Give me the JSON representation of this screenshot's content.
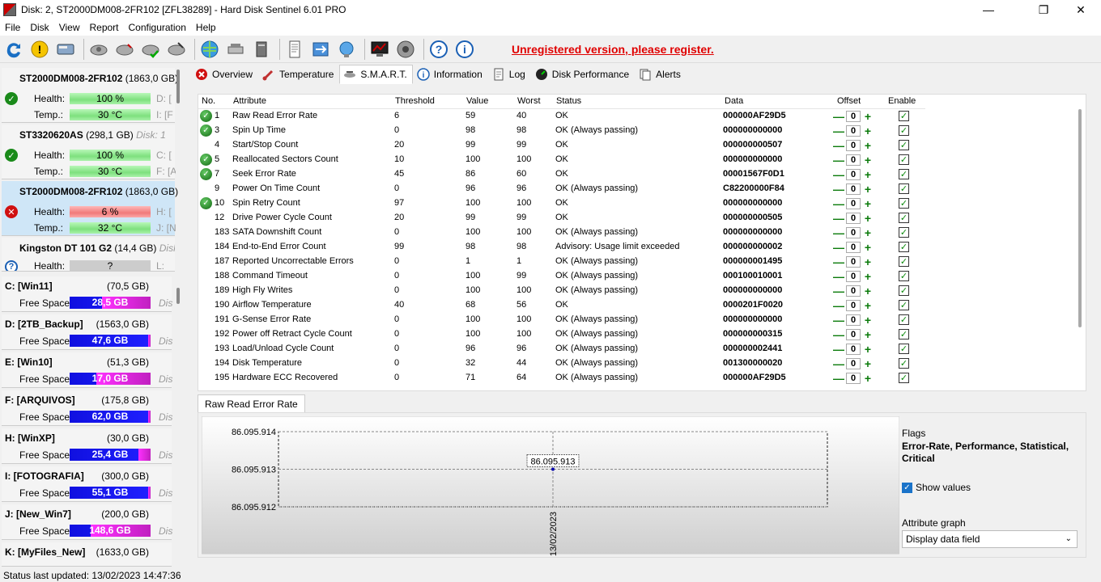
{
  "window": {
    "title": "Disk: 2, ST2000DM008-2FR102 [ZFL38289]  -  Hard Disk Sentinel 6.01 PRO"
  },
  "menu": [
    "File",
    "Disk",
    "View",
    "Report",
    "Configuration",
    "Help"
  ],
  "toolbar": {
    "unregistered": "Unregistered version, please register."
  },
  "disks": [
    {
      "name": "ST2000DM008-2FR102",
      "size": "(1863,0 GB)",
      "health_label": "Health:",
      "health": "100 %",
      "health_fraction": 1.0,
      "temp_label": "Temp.:",
      "temp": "30 °C",
      "tag1": "D: [",
      "tag2": "I: [F",
      "status": "ok"
    },
    {
      "name": "ST3320620AS",
      "size": "(298,1 GB)",
      "disk_tag": "Disk: 1",
      "health_label": "Health:",
      "health": "100 %",
      "health_fraction": 1.0,
      "temp_label": "Temp.:",
      "temp": "30 °C",
      "tag1": "C: [",
      "tag2": "F: [A",
      "status": "ok"
    },
    {
      "name": "ST2000DM008-2FR102",
      "size": "(1863,0 GB)",
      "health_label": "Health:",
      "health": "6 %",
      "health_fraction": 0.06,
      "temp_label": "Temp.:",
      "temp": "32 °C",
      "tag1": "H: [",
      "tag2": "J: [N",
      "status": "bad"
    },
    {
      "name": "Kingston DT 101 G2",
      "size": "(14,4 GB)",
      "disk_tag": "Disk",
      "health_label": "Health:",
      "health": "?",
      "tag1": "L:",
      "status": "unknown"
    }
  ],
  "volumes": [
    {
      "name": "C: [Win11]",
      "size": "(70,5 GB)",
      "free_label": "Free Space",
      "free": "28,5 GB",
      "free_fraction": 0.4,
      "tag": "Dis"
    },
    {
      "name": "D: [2TB_Backup]",
      "size": "(1563,0 GB)",
      "free_label": "Free Space",
      "free": "47,6 GB",
      "free_fraction": 0.97,
      "tag": "Dis"
    },
    {
      "name": "E: [Win10]",
      "size": "(51,3 GB)",
      "free_label": "Free Space",
      "free": "17,0 GB",
      "free_fraction": 0.33,
      "tag": "Dis"
    },
    {
      "name": "F: [ARQUIVOS]",
      "size": "(175,8 GB)",
      "free_label": "Free Space",
      "free": "62,0 GB",
      "free_fraction": 0.97,
      "tag": "Dis"
    },
    {
      "name": "H: [WinXP]",
      "size": "(30,0 GB)",
      "free_label": "Free Space",
      "free": "25,4 GB",
      "free_fraction": 0.85,
      "tag": "Dis"
    },
    {
      "name": "I: [FOTOGRAFIA]",
      "size": "(300,0 GB)",
      "free_label": "Free Space",
      "free": "55,1 GB",
      "free_fraction": 0.97,
      "tag": "Dis"
    },
    {
      "name": "J: [New_Win7]",
      "size": "(200,0 GB)",
      "free_label": "Free Space",
      "free": "148,6 GB",
      "free_fraction": 0.26,
      "tag": "Dis"
    },
    {
      "name": "K: [MyFiles_New]",
      "size": "(1633,0 GB)"
    }
  ],
  "tabs": [
    "Overview",
    "Temperature",
    "S.M.A.R.T.",
    "Information",
    "Log",
    "Disk Performance",
    "Alerts"
  ],
  "smart": {
    "headers": [
      "No.",
      "Attribute",
      "Threshold",
      "Value",
      "Worst",
      "Status",
      "Data",
      "Offset",
      "Enable"
    ],
    "rows": [
      {
        "no": "1",
        "attr": "Raw Read Error Rate",
        "thr": "6",
        "val": "59",
        "worst": "40",
        "status": "OK",
        "data": "000000AF29D5",
        "ok": true
      },
      {
        "no": "3",
        "attr": "Spin Up Time",
        "thr": "0",
        "val": "98",
        "worst": "98",
        "status": "OK (Always passing)",
        "data": "000000000000",
        "ok": true
      },
      {
        "no": "4",
        "attr": "Start/Stop Count",
        "thr": "20",
        "val": "99",
        "worst": "99",
        "status": "OK",
        "data": "000000000507",
        "ok": false
      },
      {
        "no": "5",
        "attr": "Reallocated Sectors Count",
        "thr": "10",
        "val": "100",
        "worst": "100",
        "status": "OK",
        "data": "000000000000",
        "ok": true
      },
      {
        "no": "7",
        "attr": "Seek Error Rate",
        "thr": "45",
        "val": "86",
        "worst": "60",
        "status": "OK",
        "data": "00001567F0D1",
        "ok": true
      },
      {
        "no": "9",
        "attr": "Power On Time Count",
        "thr": "0",
        "val": "96",
        "worst": "96",
        "status": "OK (Always passing)",
        "data": "C82200000F84",
        "ok": false
      },
      {
        "no": "10",
        "attr": "Spin Retry Count",
        "thr": "97",
        "val": "100",
        "worst": "100",
        "status": "OK",
        "data": "000000000000",
        "ok": true
      },
      {
        "no": "12",
        "attr": "Drive Power Cycle Count",
        "thr": "20",
        "val": "99",
        "worst": "99",
        "status": "OK",
        "data": "000000000505",
        "ok": false
      },
      {
        "no": "183",
        "attr": "SATA Downshift Count",
        "thr": "0",
        "val": "100",
        "worst": "100",
        "status": "OK (Always passing)",
        "data": "000000000000",
        "ok": false
      },
      {
        "no": "184",
        "attr": "End-to-End Error Count",
        "thr": "99",
        "val": "98",
        "worst": "98",
        "status": "Advisory: Usage limit exceeded",
        "data": "000000000002",
        "ok": false
      },
      {
        "no": "187",
        "attr": "Reported Uncorrectable Errors",
        "thr": "0",
        "val": "1",
        "worst": "1",
        "status": "OK (Always passing)",
        "data": "000000001495",
        "ok": false
      },
      {
        "no": "188",
        "attr": "Command Timeout",
        "thr": "0",
        "val": "100",
        "worst": "99",
        "status": "OK (Always passing)",
        "data": "000100010001",
        "ok": false
      },
      {
        "no": "189",
        "attr": "High Fly Writes",
        "thr": "0",
        "val": "100",
        "worst": "100",
        "status": "OK (Always passing)",
        "data": "000000000000",
        "ok": false
      },
      {
        "no": "190",
        "attr": "Airflow Temperature",
        "thr": "40",
        "val": "68",
        "worst": "56",
        "status": "OK",
        "data": "0000201F0020",
        "ok": false
      },
      {
        "no": "191",
        "attr": "G-Sense Error Rate",
        "thr": "0",
        "val": "100",
        "worst": "100",
        "status": "OK (Always passing)",
        "data": "000000000000",
        "ok": false
      },
      {
        "no": "192",
        "attr": "Power off Retract Cycle Count",
        "thr": "0",
        "val": "100",
        "worst": "100",
        "status": "OK (Always passing)",
        "data": "000000000315",
        "ok": false
      },
      {
        "no": "193",
        "attr": "Load/Unload Cycle Count",
        "thr": "0",
        "val": "96",
        "worst": "96",
        "status": "OK (Always passing)",
        "data": "000000002441",
        "ok": false
      },
      {
        "no": "194",
        "attr": "Disk Temperature",
        "thr": "0",
        "val": "32",
        "worst": "44",
        "status": "OK (Always passing)",
        "data": "001300000020",
        "ok": false
      },
      {
        "no": "195",
        "attr": "Hardware ECC Recovered",
        "thr": "0",
        "val": "71",
        "worst": "64",
        "status": "OK (Always passing)",
        "data": "000000AF29D5",
        "ok": false
      }
    ],
    "offset_value": "0"
  },
  "graph": {
    "tab_label": "Raw Read Error Rate",
    "flags_title": "Flags",
    "flags": "Error-Rate, Performance, Statistical, Critical",
    "show_values_label": "Show values",
    "attribute_graph_label": "Attribute graph",
    "attribute_graph_value": "Display data field"
  },
  "chart_data": {
    "type": "line",
    "x": [
      "13/02/2023"
    ],
    "y": [
      86095913
    ],
    "y_tick_labels": [
      "86.095.914",
      "86.095.913",
      "86.095.912"
    ],
    "point_label": "86.095.913",
    "ylim": [
      86095912,
      86095914
    ],
    "grid": true
  },
  "status": {
    "text": "Status last updated: 13/02/2023 14:47:36"
  }
}
